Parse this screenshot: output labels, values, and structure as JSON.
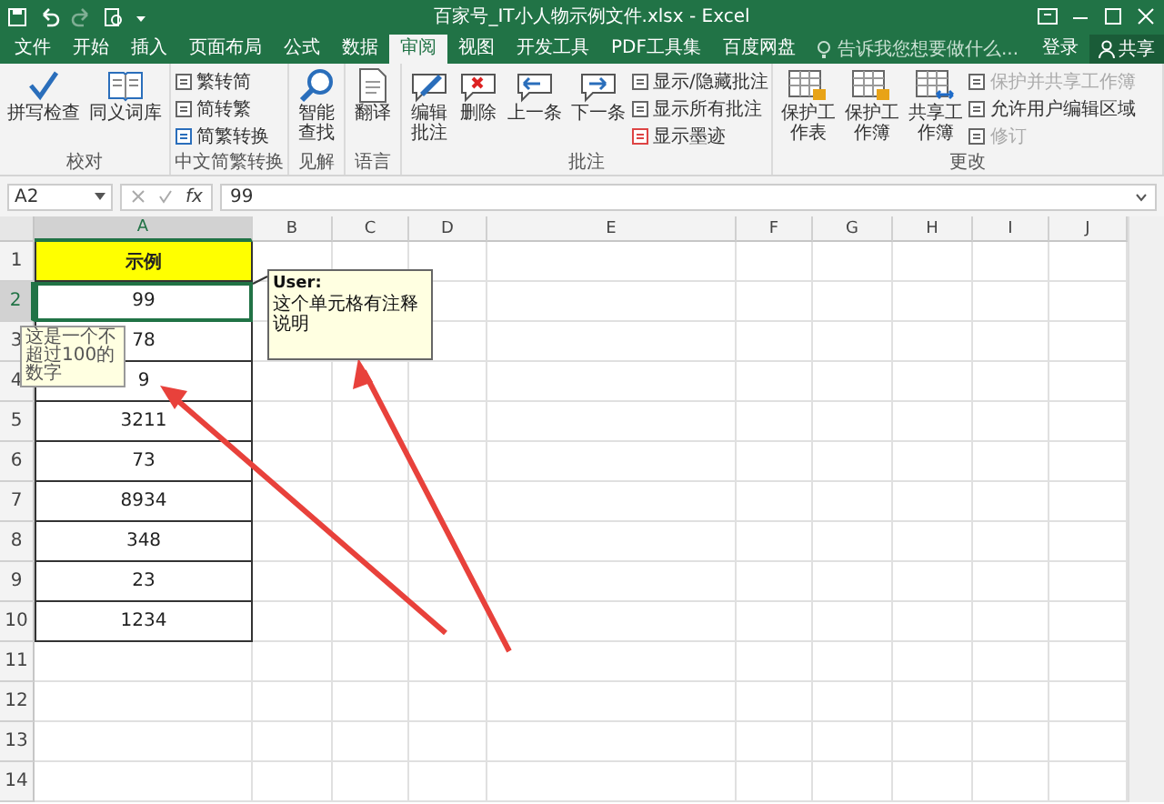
{
  "window": {
    "title": "百家号_IT小人物示例文件.xlsx - Excel"
  },
  "tabs": [
    {
      "label": "文件",
      "selected": false
    },
    {
      "label": "开始",
      "selected": false
    },
    {
      "label": "插入",
      "selected": false
    },
    {
      "label": "页面布局",
      "selected": false
    },
    {
      "label": "公式",
      "selected": false
    },
    {
      "label": "数据",
      "selected": false
    },
    {
      "label": "审阅",
      "selected": true
    },
    {
      "label": "视图",
      "selected": false
    },
    {
      "label": "开发工具",
      "selected": false
    },
    {
      "label": "PDF工具集",
      "selected": false
    },
    {
      "label": "百度网盘",
      "selected": false
    }
  ],
  "tell_me": {
    "placeholder": "告诉我您想要做什么..."
  },
  "account": {
    "sign_in": "登录",
    "share": "共享"
  },
  "ribbon_groups": [
    {
      "label": "校对",
      "commands": [
        {
          "label": "拼写检查",
          "kind": "large",
          "disabled": false
        },
        {
          "label": "同义词库",
          "kind": "large",
          "disabled": false
        }
      ]
    },
    {
      "label": "中文简繁转换",
      "commands": [
        {
          "label": "繁转简",
          "kind": "small",
          "disabled": false
        },
        {
          "label": "简转繁",
          "kind": "small",
          "disabled": false
        },
        {
          "label": "简繁转换",
          "kind": "small",
          "disabled": false
        }
      ]
    },
    {
      "label": "见解",
      "commands": [
        {
          "label": "智能查找",
          "kind": "large_stacked",
          "disabled": false
        }
      ]
    },
    {
      "label": "语言",
      "commands": [
        {
          "label": "翻译",
          "kind": "large",
          "disabled": false
        }
      ]
    },
    {
      "label": "批注",
      "commands": [
        {
          "label": "编辑批注",
          "kind": "large_stacked",
          "disabled": false
        },
        {
          "label": "删除",
          "kind": "large",
          "disabled": false
        },
        {
          "label": "上一条",
          "kind": "large",
          "disabled": false
        },
        {
          "label": "下一条",
          "kind": "large",
          "disabled": false
        },
        {
          "label": "显示/隐藏批注",
          "kind": "small",
          "disabled": false
        },
        {
          "label": "显示所有批注",
          "kind": "small",
          "disabled": false
        },
        {
          "label": "显示墨迹",
          "kind": "small",
          "disabled": false
        }
      ]
    },
    {
      "label": "更改",
      "commands": [
        {
          "label": "保护工作表",
          "kind": "large_stacked",
          "disabled": false
        },
        {
          "label": "保护工作簿",
          "kind": "large_stacked",
          "disabled": false
        },
        {
          "label": "共享工作簿",
          "kind": "large_stacked",
          "disabled": false
        },
        {
          "label": "保护并共享工作簿",
          "kind": "small",
          "disabled": true
        },
        {
          "label": "允许用户编辑区域",
          "kind": "small",
          "disabled": false
        },
        {
          "label": "修订",
          "kind": "small",
          "disabled": true
        }
      ]
    }
  ],
  "formula_bar": {
    "name_box": "A2",
    "function_label": "fx",
    "value": "99"
  },
  "sheet": {
    "columns": [
      {
        "label": "A",
        "selected": true
      },
      {
        "label": "B",
        "selected": false
      },
      {
        "label": "C",
        "selected": false
      },
      {
        "label": "D",
        "selected": false
      },
      {
        "label": "E",
        "selected": false
      },
      {
        "label": "F",
        "selected": false
      },
      {
        "label": "G",
        "selected": false
      },
      {
        "label": "H",
        "selected": false
      },
      {
        "label": "I",
        "selected": false
      },
      {
        "label": "J",
        "selected": false
      }
    ],
    "rows": [
      {
        "label": "1",
        "selected": false,
        "kind": "header",
        "value": "示例"
      },
      {
        "label": "2",
        "selected": true,
        "kind": "data",
        "value": "99"
      },
      {
        "label": "3",
        "selected": false,
        "kind": "data",
        "value": "78"
      },
      {
        "label": "4",
        "selected": false,
        "kind": "data",
        "value": "9"
      },
      {
        "label": "5",
        "selected": false,
        "kind": "data",
        "value": "3211"
      },
      {
        "label": "6",
        "selected": false,
        "kind": "data",
        "value": "73"
      },
      {
        "label": "7",
        "selected": false,
        "kind": "data",
        "value": "8934"
      },
      {
        "label": "8",
        "selected": false,
        "kind": "data",
        "value": "348"
      },
      {
        "label": "9",
        "selected": false,
        "kind": "data",
        "value": "23"
      },
      {
        "label": "10",
        "selected": false,
        "kind": "data",
        "value": "1234"
      },
      {
        "label": "11",
        "selected": false,
        "kind": "empty"
      },
      {
        "label": "12",
        "selected": false,
        "kind": "empty"
      },
      {
        "label": "13",
        "selected": false,
        "kind": "empty"
      },
      {
        "label": "14",
        "selected": false,
        "kind": "empty"
      }
    ]
  },
  "comments": [
    {
      "kind": "input_message",
      "text": "这是一个不超过100的数字"
    },
    {
      "kind": "note",
      "author": "User:",
      "text": "这个单元格有注释说明"
    }
  ]
}
